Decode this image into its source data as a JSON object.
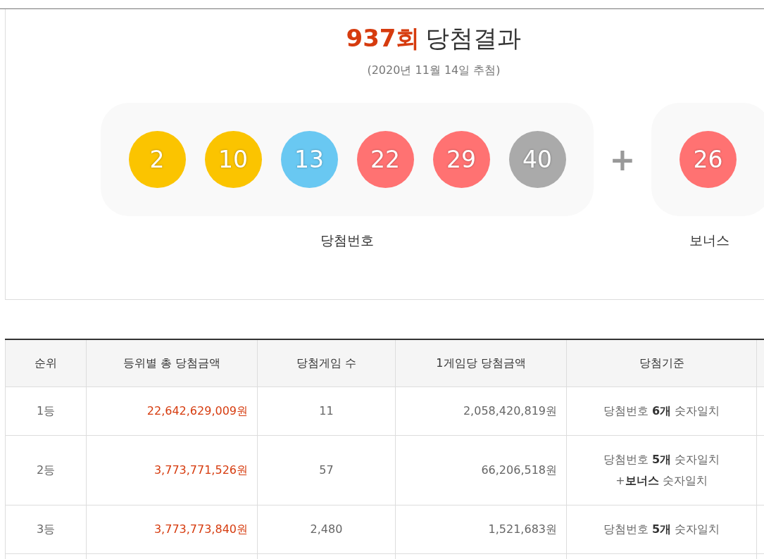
{
  "title": {
    "round": "937회",
    "text": "당첨결과"
  },
  "date": "(2020년 11월 14일 추첨)",
  "numbers": [
    {
      "value": "2",
      "color": "#fbc400"
    },
    {
      "value": "10",
      "color": "#fbc400"
    },
    {
      "value": "13",
      "color": "#69c8f2"
    },
    {
      "value": "22",
      "color": "#ff7272"
    },
    {
      "value": "29",
      "color": "#ff7272"
    },
    {
      "value": "40",
      "color": "#aaaaaa"
    }
  ],
  "plus": "+",
  "numbers_label": "당첨번호",
  "bonus": {
    "value": "26",
    "color": "#ff7272"
  },
  "bonus_label": "보너스",
  "table": {
    "columns": [
      "순위",
      "등위별 총 당첨금액",
      "당첨게임 수",
      "1게임당 당첨금액",
      "당첨기준"
    ],
    "rows": [
      {
        "rank": "1등",
        "total": "22,642,629,009원",
        "games": "11",
        "per_game": "2,058,420,819원",
        "criteria": [
          "당첨번호 **6개** 숫자일치"
        ]
      },
      {
        "rank": "2등",
        "total": "3,773,771,526원",
        "games": "57",
        "per_game": "66,206,518원",
        "criteria": [
          "당첨번호 **5개** 숫자일치",
          "+**보너스** 숫자일치"
        ]
      },
      {
        "rank": "3등",
        "total": "3,773,773,840원",
        "games": "2,480",
        "per_game": "1,521,683원",
        "criteria": [
          "당첨번호 **5개** 숫자일치"
        ]
      }
    ]
  }
}
